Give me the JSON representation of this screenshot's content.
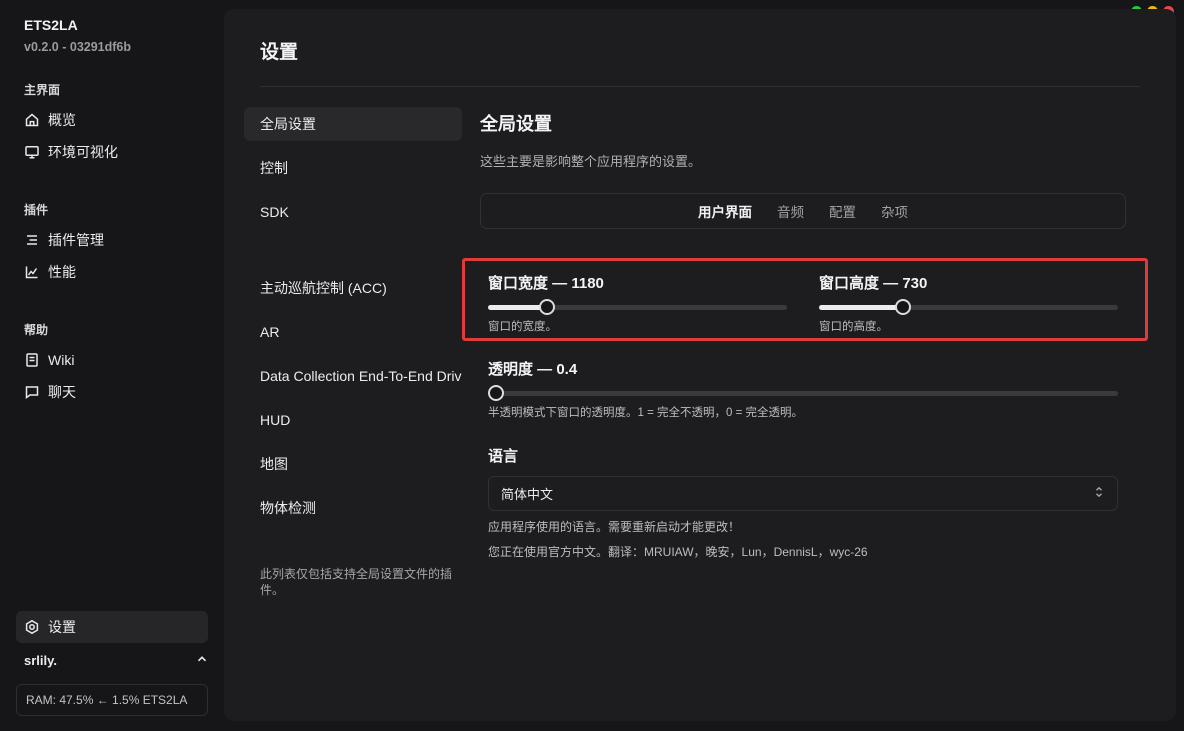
{
  "app": {
    "name": "ETS2LA",
    "version": "v0.2.0 - 03291df6b"
  },
  "sidebar": {
    "groups": [
      {
        "title": "主界面",
        "items": [
          {
            "label": "概览",
            "icon": "home-icon"
          },
          {
            "label": "环境可视化",
            "icon": "monitor-icon"
          }
        ]
      },
      {
        "title": "插件",
        "items": [
          {
            "label": "插件管理",
            "icon": "list-icon"
          },
          {
            "label": "性能",
            "icon": "chart-icon"
          }
        ]
      },
      {
        "title": "帮助",
        "items": [
          {
            "label": "Wiki",
            "icon": "book-icon"
          },
          {
            "label": "聊天",
            "icon": "chat-icon"
          }
        ]
      }
    ],
    "settings_label": "设置",
    "user": "srlily.",
    "ram": "RAM: 47.5% ← 1.5% ETS2LA"
  },
  "page": {
    "title": "设置",
    "categories": [
      "全局设置",
      "控制",
      "SDK",
      "主动巡航控制 (ACC)",
      "AR",
      "Data Collection End-To-End Driving",
      "HUD",
      "地图",
      "物体检测"
    ],
    "categories_note": "此列表仅包括支持全局设置文件的插件。"
  },
  "section": {
    "title": "全局设置",
    "description": "这些主要是影响整个应用程序的设置。",
    "tabs": [
      "用户界面",
      "音频",
      "配置",
      "杂项"
    ],
    "active_tab": "用户界面"
  },
  "settings": {
    "width": {
      "label": "窗口宽度 — 1180",
      "help": "窗口的宽度。",
      "fraction": 0.18
    },
    "height": {
      "label": "窗口高度 — 730",
      "help": "窗口的高度。",
      "fraction": 0.27
    },
    "transparency": {
      "label": "透明度 — 0.4",
      "help": "半透明模式下窗口的透明度。1 = 完全不透明，0 = 完全透明。",
      "fraction": 0.0
    },
    "language": {
      "label": "语言",
      "value": "简体中文",
      "help": "应用程序使用的语言。需要重新启动才能更改！",
      "translators": "您正在使用官方中文。翻译：MRUIAW，晚安，Lun，DennisL，wyc-26"
    }
  },
  "colors": {
    "accent_highlight": "#e03b3b",
    "background": "#161618",
    "panel": "#1d1d20"
  }
}
